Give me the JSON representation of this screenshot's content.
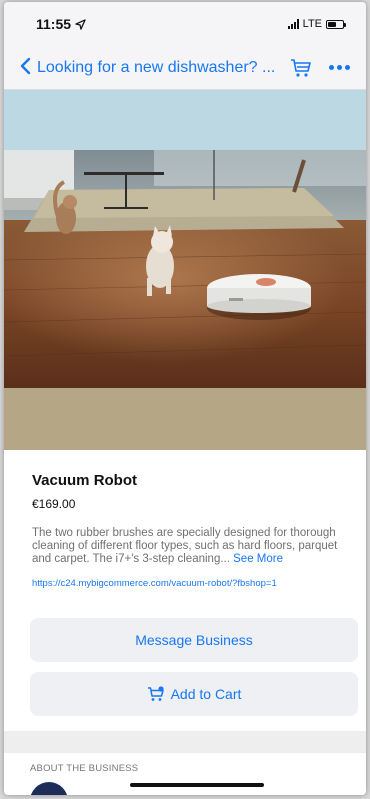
{
  "status_bar": {
    "time": "11:55",
    "network": "LTE"
  },
  "nav": {
    "title": "Looking for a new dishwasher? ..."
  },
  "product": {
    "name": "Vacuum Robot",
    "price": "€169.00",
    "description": "The two rubber brushes are specially designed for thorough cleaning of different floor types, such as hard floors, parquet and carpet. The i7+'s 3-step cleaning...",
    "see_more": "See More",
    "link": "https://c24.mybigcommerce.com/vacuum-robot/?fbshop=1"
  },
  "actions": {
    "message_label": "Message Business",
    "add_to_cart_label": "Add to Cart"
  },
  "about": {
    "section_label": "ABOUT THE BUSINESS"
  },
  "colors": {
    "accent": "#1877f2",
    "button_bg": "#eef0f4",
    "avatar": "#1c2d5a"
  },
  "icons": [
    "location-arrow-icon",
    "signal-icon",
    "battery-icon",
    "chevron-left-icon",
    "cart-icon",
    "more-icon",
    "cart-add-icon"
  ]
}
